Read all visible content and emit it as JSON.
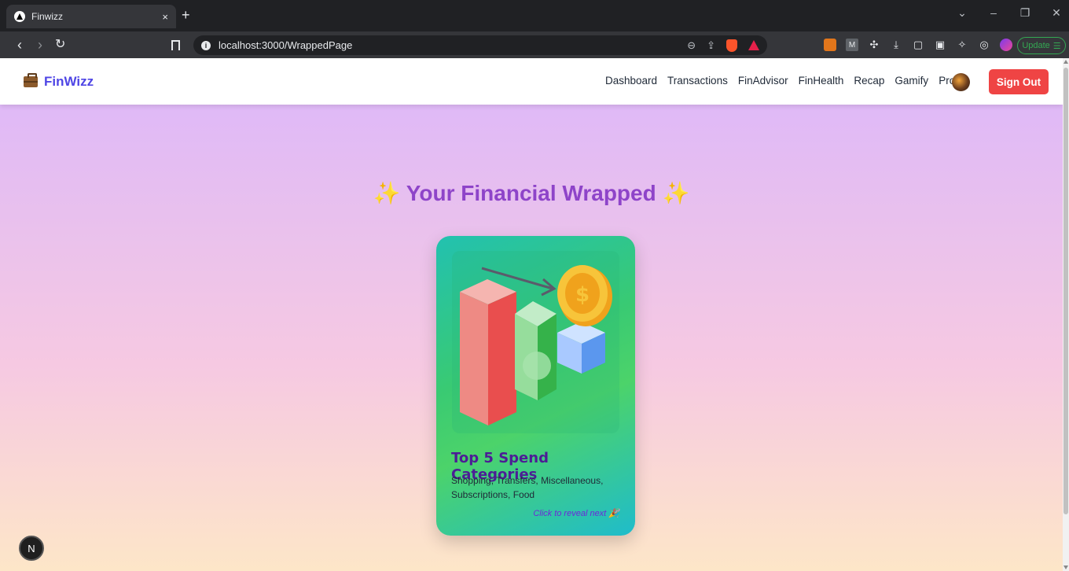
{
  "browser": {
    "tab_title": "Finwizz",
    "tab_close": "×",
    "new_tab": "+",
    "url": "localhost:3000/WrappedPage",
    "update_label": "Update",
    "window_controls": [
      "⌄",
      "–",
      "❐",
      "✕"
    ]
  },
  "nav": {
    "brand": "FinWizz",
    "links": [
      "Dashboard",
      "Transactions",
      "FinAdvisor",
      "FinHealth",
      "Recap",
      "Gamify",
      "Profile"
    ],
    "signout_label": "Sign Out"
  },
  "main": {
    "headline_left": "✨",
    "headline": "Your Financial Wrapped",
    "headline_right": "✨",
    "card": {
      "title": "Top 5 Spend Categories",
      "description": "Shopping, Transfers, Miscellaneous, Subscriptions, Food",
      "cta": "Click to reveal next 🎉"
    }
  },
  "devtools_badge": "N",
  "colors": {
    "brand": "#4f46e5",
    "signout": "#ef4444",
    "headline": "#8e44c9",
    "card_title": "#4c1d95"
  }
}
